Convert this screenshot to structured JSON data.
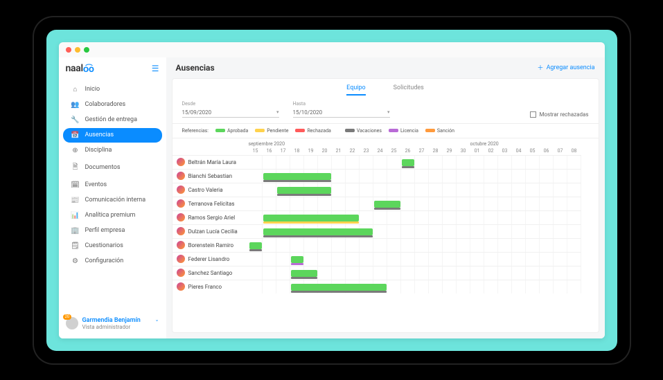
{
  "brand": "naaloo",
  "sidebar": {
    "items": [
      {
        "icon": "⌂",
        "label": "Inicio"
      },
      {
        "icon": "👥",
        "label": "Colaboradores"
      },
      {
        "icon": "🔧",
        "label": "Gestión de entrega"
      },
      {
        "icon": "📅",
        "label": "Ausencias"
      },
      {
        "icon": "⊕",
        "label": "Disciplina"
      },
      {
        "icon": "🗎",
        "label": "Documentos"
      },
      {
        "icon": "🗓",
        "label": "Eventos"
      },
      {
        "icon": "📰",
        "label": "Comunicación interna"
      },
      {
        "icon": "📊",
        "label": "Analítica premium"
      },
      {
        "icon": "🏢",
        "label": "Perfil empresa"
      },
      {
        "icon": "🗒",
        "label": "Cuestionarios"
      },
      {
        "icon": "⚙",
        "label": "Configuración"
      }
    ]
  },
  "user": {
    "badge": "20",
    "name": "Garmendia Benjamín",
    "role": "Vista administrador"
  },
  "page": {
    "title": "Ausencias",
    "add_label": "Agregar ausencia"
  },
  "tabs": {
    "team": "Equipo",
    "requests": "Solicitudes"
  },
  "filters": {
    "from_label": "Desde",
    "from_value": "15/09/2020",
    "to_label": "Hasta",
    "to_value": "15/10/2020",
    "show_rejected": "Mostrar rechazadas"
  },
  "legend": {
    "title": "Referencias:",
    "approved": "Aprobada",
    "pending": "Pendiente",
    "rejected": "Rechazada",
    "vacations": "Vacaciones",
    "license": "Licencia",
    "sanction": "Sanción",
    "colors": {
      "approved": "#5cd65c",
      "pending": "#ffd24d",
      "rejected": "#ff5a5a",
      "vacations": "#7a7a7a",
      "license": "#b96bd6",
      "sanction": "#ff9a3c"
    }
  },
  "timeline": {
    "months": [
      {
        "label": "septiembre 2020",
        "span": 16
      },
      {
        "label": "octubre 2020",
        "span": 8
      }
    ],
    "days": [
      "15",
      "16",
      "17",
      "18",
      "19",
      "20",
      "21",
      "22",
      "23",
      "24",
      "25",
      "26",
      "27",
      "28",
      "29",
      "30",
      "01",
      "02",
      "03",
      "04",
      "05",
      "06",
      "07",
      "08"
    ]
  },
  "chart_data": {
    "type": "gantt",
    "x_unit": "day",
    "x_range": [
      "2020-09-15",
      "2020-10-08"
    ],
    "rows": [
      {
        "name": "Beltrán María Laura",
        "bars": [
          {
            "start": 11,
            "len": 1,
            "status": "approved",
            "type": "vacations"
          }
        ]
      },
      {
        "name": "Bianchi Sebastian",
        "bars": [
          {
            "start": 1,
            "len": 5,
            "status": "approved",
            "type": "vacations"
          }
        ]
      },
      {
        "name": "Castro Valeria",
        "bars": [
          {
            "start": 2,
            "len": 4,
            "status": "approved",
            "type": "vacations"
          }
        ]
      },
      {
        "name": "Terranova Felicitas",
        "bars": [
          {
            "start": 9,
            "len": 2,
            "status": "approved",
            "type": "vacations"
          }
        ]
      },
      {
        "name": "Ramos Sergio Ariel",
        "bars": [
          {
            "start": 1,
            "len": 7,
            "status": "approved",
            "type": "pending_under",
            "under": "#ffd24d"
          }
        ]
      },
      {
        "name": "Dulzan Lucía Cecilia",
        "bars": [
          {
            "start": 1,
            "len": 8,
            "status": "approved",
            "type": "vacations"
          }
        ]
      },
      {
        "name": "Borenstein Ramiro",
        "bars": [
          {
            "start": 0,
            "len": 1,
            "status": "approved",
            "type": "vacations"
          }
        ]
      },
      {
        "name": "Federer Lisandro",
        "bars": [
          {
            "start": 3,
            "len": 1,
            "status": "approved",
            "type": "license",
            "under": "#b96bd6"
          }
        ]
      },
      {
        "name": "Sanchez Santiago",
        "bars": [
          {
            "start": 3,
            "len": 2,
            "status": "approved",
            "type": "vacations"
          }
        ]
      },
      {
        "name": "Pieres Franco",
        "bars": [
          {
            "start": 3,
            "len": 7,
            "status": "approved",
            "type": "vacations"
          }
        ]
      }
    ]
  }
}
